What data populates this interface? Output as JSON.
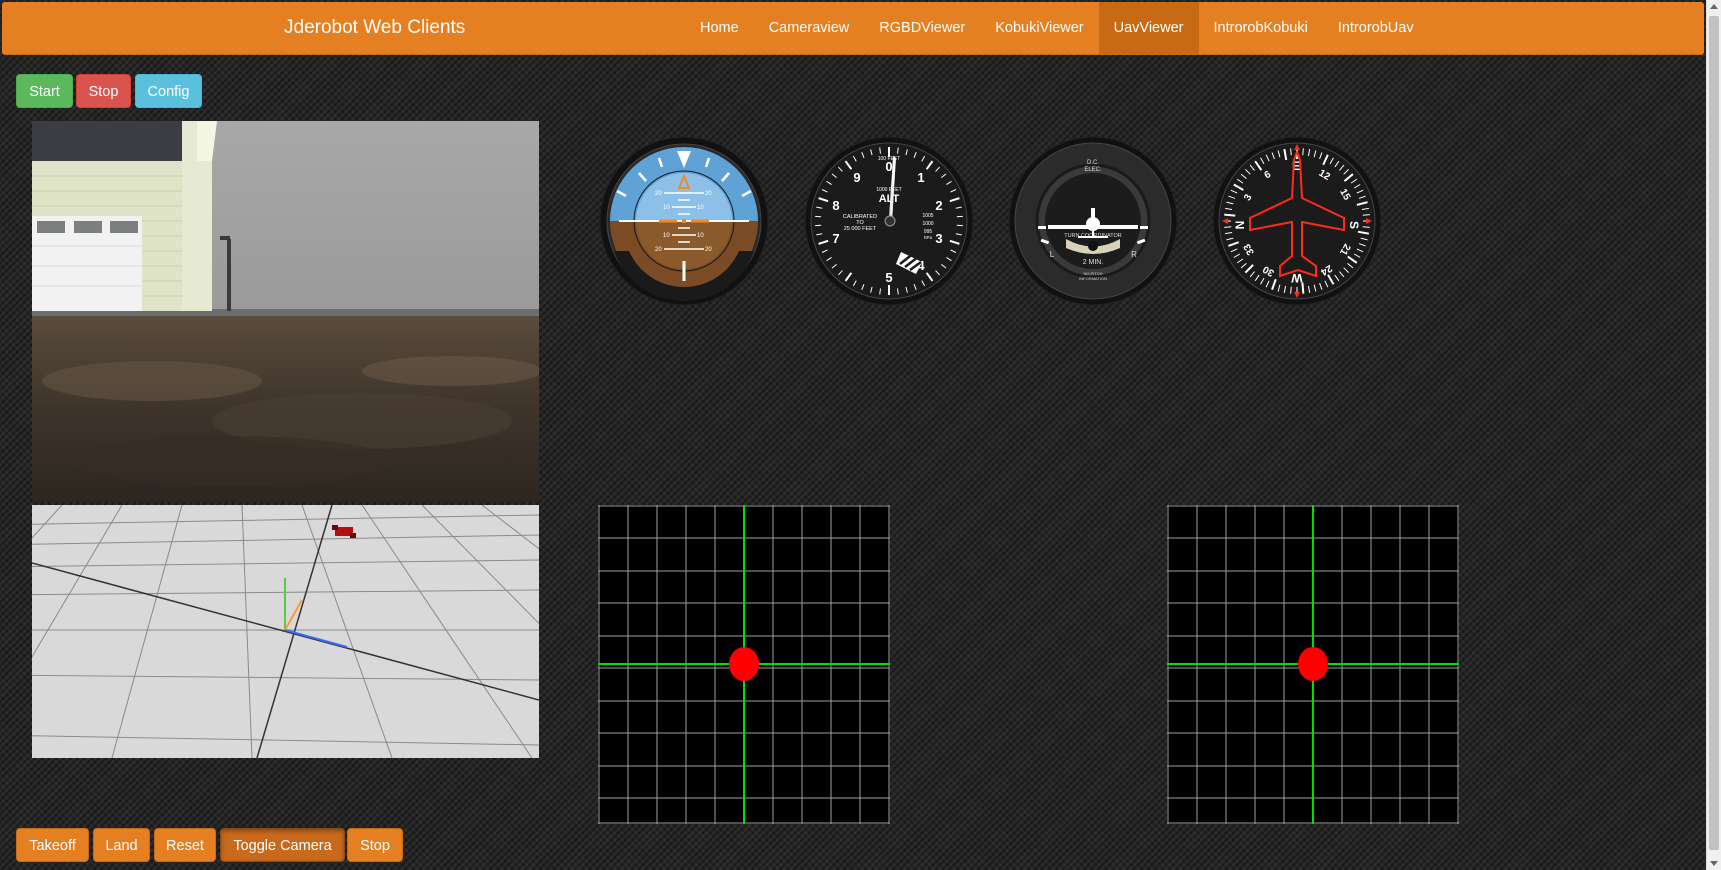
{
  "navbar": {
    "brand": "Jderobot Web Clients",
    "items": [
      {
        "label": "Home"
      },
      {
        "label": "Cameraview"
      },
      {
        "label": "RGBDViewer"
      },
      {
        "label": "KobukiViewer"
      },
      {
        "label": "UavViewer",
        "active": true
      },
      {
        "label": "IntrorobKobuki"
      },
      {
        "label": "IntrorobUav"
      }
    ]
  },
  "top_controls": {
    "start": "Start",
    "stop": "Stop",
    "config": "Config"
  },
  "gauges": {
    "attitude": {
      "ticks": [
        "20",
        "10",
        "10",
        "20"
      ]
    },
    "altimeter": {
      "numbers": [
        "0",
        "1",
        "2",
        "3",
        "4",
        "5",
        "6",
        "7",
        "8",
        "9"
      ],
      "label": "ALT",
      "sub_top": "100 FEET",
      "sub_mid": "1000 FEET",
      "calibrated_1": "CALIBRATED",
      "calibrated_2": "TO",
      "calibrated_3": "25 000 FEET",
      "pressure_1": "1005",
      "pressure_2": "1000",
      "pressure_3": "995",
      "pressure_unit": "hPa"
    },
    "turn_coordinator": {
      "top_1": "D.C.",
      "top_2": "ELEC.",
      "title": "TURN COORDINATOR",
      "left": "L",
      "right": "R",
      "minutes": "2 MIN.",
      "note_1": "NO PITCH",
      "note_2": "INFORMATION"
    },
    "heading": {
      "labels": [
        "N",
        "3",
        "6",
        "E",
        "12",
        "15",
        "S",
        "21",
        "24",
        "W",
        "30",
        "33"
      ]
    }
  },
  "bottom_controls": {
    "takeoff": "Takeoff",
    "land": "Land",
    "reset": "Reset",
    "toggle_camera": "Toggle Camera",
    "stop": "Stop"
  },
  "colors": {
    "navbar": "#e47f22",
    "start": "#5cb85c",
    "stop": "#d9534f",
    "config": "#5bc0de",
    "pad_axis": "#00e000",
    "pad_knob": "#ff0000"
  }
}
